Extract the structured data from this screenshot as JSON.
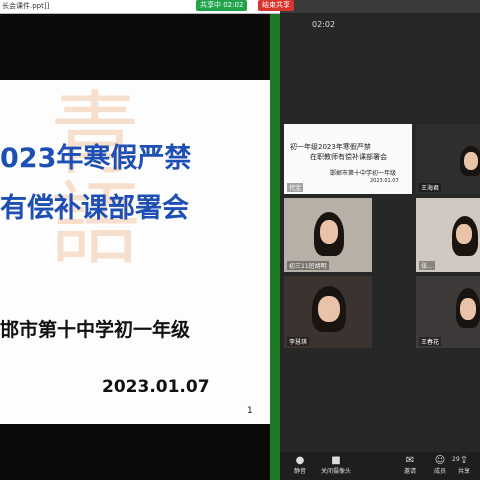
{
  "window": {
    "title": "长会课件.ppt]]"
  },
  "share_bar": {
    "sharing_label": "共享中 02:02",
    "stop_label": "结束共享"
  },
  "slide": {
    "title_line1": "023年寒假严禁",
    "title_line2": "有偿补课部署会",
    "subtitle": "邯市第十中学初一年级",
    "date": "2023.01.07",
    "page_number": "1"
  },
  "panel": {
    "time": "02:02",
    "tiles": [
      {
        "name": "代宝",
        "kind": "slide",
        "mini_line1": "初一年级2023年寒假严禁",
        "mini_line2": "在职教师有偿补课部署会",
        "mini_line3": "邯郸市第十中学初一年级",
        "mini_line4": "2023.01.07"
      },
      {
        "name": "王海君"
      },
      {
        "name": "初三11班胡明"
      },
      {
        "name": "张..."
      },
      {
        "name": "李慧琪"
      },
      {
        "name": "王春花"
      }
    ]
  },
  "toolbar": {
    "items": [
      {
        "icon": "mic-icon",
        "label": "静音"
      },
      {
        "icon": "camera-icon",
        "label": "关闭摄像头"
      },
      {
        "icon": "invite-icon",
        "label": "邀请"
      },
      {
        "icon": "members-icon",
        "label": "成员"
      },
      {
        "icon": "share-icon",
        "label": "共享"
      }
    ],
    "member_count": "29"
  }
}
